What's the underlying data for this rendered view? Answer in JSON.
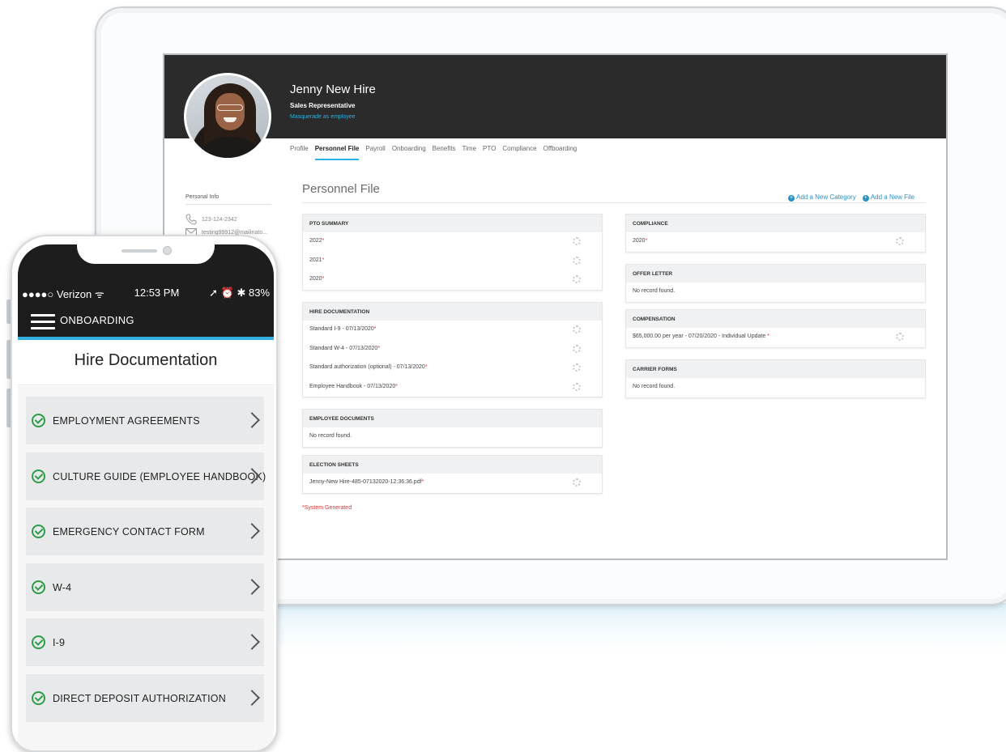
{
  "profile": {
    "name": "Jenny New Hire",
    "role": "Sales Representative",
    "masquerade": "Masquerade as employee"
  },
  "tabs": [
    {
      "label": "Profile"
    },
    {
      "label": "Personnel File",
      "active": true
    },
    {
      "label": "Payroll"
    },
    {
      "label": "Onboarding"
    },
    {
      "label": "Benefits"
    },
    {
      "label": "Time"
    },
    {
      "label": "PTO"
    },
    {
      "label": "Compliance"
    },
    {
      "label": "Offboarding"
    }
  ],
  "sidebar": {
    "label": "Personal Info",
    "phone": "123-124-2342",
    "email": "testing99912@mailinato...",
    "phone_icon": "phone-icon",
    "email_icon": "envelope-icon"
  },
  "main": {
    "title": "Personnel File",
    "add_category": "Add a New Category",
    "add_file": "Add a New File",
    "system_generated": "*System Generated"
  },
  "cards": {
    "pto_summary": {
      "title": "PTO SUMMARY",
      "rows": [
        "2022",
        "2021",
        "2020"
      ]
    },
    "hire_documentation": {
      "title": "HIRE DOCUMENTATION",
      "rows": [
        "Standard I-9 - 07/13/2020",
        "Standard W-4 - 07/13/2020",
        "Standard authorization (optional) - 07/13/2020",
        "Employee Handbook - 07/13/2020"
      ]
    },
    "employee_documents": {
      "title": "EMPLOYEE DOCUMENTS",
      "empty": "No record found."
    },
    "election_sheets": {
      "title": "ELECTION SHEETS",
      "rows": [
        "Jenny-New Hire-485-07132020-12:36:36.pdf"
      ]
    },
    "compliance": {
      "title": "COMPLIANCE",
      "rows": [
        "2020"
      ]
    },
    "offer_letter": {
      "title": "OFFER LETTER",
      "empty": "No record found."
    },
    "compensation": {
      "title": "COMPENSATION",
      "rows": [
        "$65,000.00 per year - 07/20/2020 - Individual Update"
      ]
    },
    "carrier_forms": {
      "title": "CARRIER FORMS",
      "empty": "No record found."
    }
  },
  "phone": {
    "carrier": "●●●●○ Verizon",
    "wifi": "ᯤ",
    "time": "12:53 PM",
    "right_status": "➚ ⏰ ✱ 83%",
    "app_title": "ONBOARDING",
    "page_title": "Hire Documentation",
    "items": [
      {
        "label": "EMPLOYMENT AGREEMENTS"
      },
      {
        "label": "CULTURE GUIDE (EMPLOYEE HANDBOOK)"
      },
      {
        "label": "EMERGENCY CONTACT FORM"
      },
      {
        "label": "W-4"
      },
      {
        "label": "I-9"
      },
      {
        "label": "DIRECT DEPOSIT AUTHORIZATION"
      }
    ]
  },
  "colors": {
    "accent": "#2ab0e6",
    "header": "#2b2b2b",
    "check": "#2e9d4a",
    "required": "#e0322f"
  }
}
